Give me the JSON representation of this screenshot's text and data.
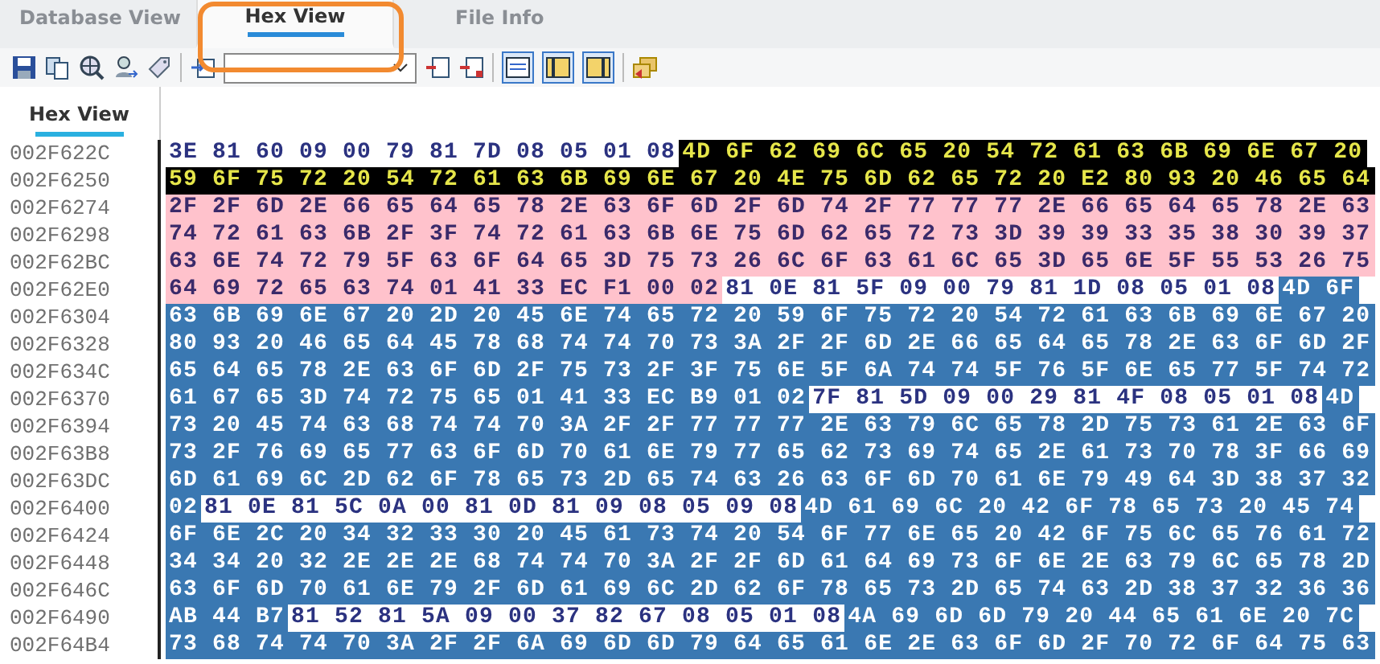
{
  "tabs": [
    {
      "label": "Database View",
      "selected": false
    },
    {
      "label": "Hex View",
      "selected": true
    },
    {
      "label": "File Info",
      "selected": false
    }
  ],
  "toolbar": {
    "toggles": [
      {
        "pressed": true
      },
      {
        "pressed": true
      },
      {
        "pressed": true
      }
    ]
  },
  "subtabs": [
    {
      "label": "Hex View",
      "selected": true
    }
  ],
  "rows": [
    {
      "address": "002F622C",
      "segments": [
        {
          "kind": "plain",
          "bytes": "3E 81 60 09 00 79 81 7D 08 05 01 08"
        },
        {
          "kind": "black",
          "bytes": "4D 6F 62 69 6C 65 20 54 72 61 63 6B 69 6E 67 20"
        }
      ]
    },
    {
      "address": "002F6250",
      "segments": [
        {
          "kind": "black",
          "bytes": "59 6F 75 72 20 54 72 61 63 6B 69 6E 67 20 4E 75 6D 62 65 72 20 E2 80 93 20 46 65 64"
        }
      ]
    },
    {
      "address": "002F6274",
      "segments": [
        {
          "kind": "pink",
          "bytes": "2F 2F 6D 2E 66 65 64 65 78 2E 63 6F 6D 2F 6D 74 2F 77 77 77 2E 66 65 64 65 78 2E 63"
        }
      ]
    },
    {
      "address": "002F6298",
      "segments": [
        {
          "kind": "pink",
          "bytes": "74 72 61 63 6B 2F 3F 74 72 61 63 6B 6E 75 6D 62 65 72 73 3D 39 39 33 35 38 30 39 37"
        }
      ]
    },
    {
      "address": "002F62BC",
      "segments": [
        {
          "kind": "pink",
          "bytes": "63 6E 74 72 79 5F 63 6F 64 65 3D 75 73 26 6C 6F 63 61 6C 65 3D 65 6E 5F 55 53 26 75"
        }
      ]
    },
    {
      "address": "002F62E0",
      "segments": [
        {
          "kind": "pink",
          "bytes": "64 69 72 65 63 74 01 41 33 EC F1 00 02"
        },
        {
          "kind": "plain",
          "bytes": "81 0E 81 5F 09 00 79 81 1D 08 05 01 08"
        },
        {
          "kind": "blue",
          "bytes": "4D 6F"
        }
      ]
    },
    {
      "address": "002F6304",
      "segments": [
        {
          "kind": "blue",
          "bytes": "63 6B 69 6E 67 20 2D 20 45 6E 74 65 72 20 59 6F 75 72 20 54 72 61 63 6B 69 6E 67 20"
        }
      ]
    },
    {
      "address": "002F6328",
      "segments": [
        {
          "kind": "blue",
          "bytes": "80 93 20 46 65 64 45 78 68 74 74 70 73 3A 2F 2F 6D 2E 66 65 64 65 78 2E 63 6F 6D 2F"
        }
      ]
    },
    {
      "address": "002F634C",
      "segments": [
        {
          "kind": "blue",
          "bytes": "65 64 65 78 2E 63 6F 6D 2F 75 73 2F 3F 75 6E 5F 6A 74 74 5F 76 5F 6E 65 77 5F 74 72"
        }
      ]
    },
    {
      "address": "002F6370",
      "segments": [
        {
          "kind": "blue",
          "bytes": "61 67 65 3D 74 72 75 65 01 41 33 EC B9 01 02"
        },
        {
          "kind": "plain",
          "bytes": "7F 81 5D 09 00 29 81 4F 08 05 01 08"
        },
        {
          "kind": "blue",
          "bytes": "4D"
        }
      ]
    },
    {
      "address": "002F6394",
      "segments": [
        {
          "kind": "blue",
          "bytes": "73 20 45 74 63 68 74 74 70 3A 2F 2F 77 77 77 2E 63 79 6C 65 78 2D 75 73 61 2E 63 6F"
        }
      ]
    },
    {
      "address": "002F63B8",
      "segments": [
        {
          "kind": "blue",
          "bytes": "73 2F 76 69 65 77 63 6F 6D 70 61 6E 79 77 65 62 73 69 74 65 2E 61 73 70 78 3F 66 69"
        }
      ]
    },
    {
      "address": "002F63DC",
      "segments": [
        {
          "kind": "blue",
          "bytes": "6D 61 69 6C 2D 62 6F 78 65 73 2D 65 74 63 26 63 6F 6D 70 61 6E 79 49 64 3D 38 37 32"
        }
      ]
    },
    {
      "address": "002F6400",
      "segments": [
        {
          "kind": "blue",
          "bytes": "02"
        },
        {
          "kind": "plain",
          "bytes": "81 0E 81 5C 0A 00 81 0D 81 09 08 05 09 08"
        },
        {
          "kind": "blue",
          "bytes": "4D 61 69 6C 20 42 6F 78 65 73 20 45 74"
        }
      ]
    },
    {
      "address": "002F6424",
      "segments": [
        {
          "kind": "blue",
          "bytes": "6F 6E 2C 20 34 32 33 30 20 45 61 73 74 20 54 6F 77 6E 65 20 42 6F 75 6C 65 76 61 72"
        }
      ]
    },
    {
      "address": "002F6448",
      "segments": [
        {
          "kind": "blue",
          "bytes": "34 34 20 32 2E 2E 2E 68 74 74 70 3A 2F 2F 6D 61 64 69 73 6F 6E 2E 63 79 6C 65 78 2D"
        }
      ]
    },
    {
      "address": "002F646C",
      "segments": [
        {
          "kind": "blue",
          "bytes": "63 6F 6D 70 61 6E 79 2F 6D 61 69 6C 2D 62 6F 78 65 73 2D 65 74 63 2D 38 37 32 36 36"
        }
      ]
    },
    {
      "address": "002F6490",
      "segments": [
        {
          "kind": "blue",
          "bytes": "AB 44 B7"
        },
        {
          "kind": "plain",
          "bytes": "81 52 81 5A 09 00 37 82 67 08 05 01 08"
        },
        {
          "kind": "blue",
          "bytes": "4A 69 6D 6D 79 20 44 65 61 6E 20 7C"
        }
      ]
    },
    {
      "address": "002F64B4",
      "segments": [
        {
          "kind": "blue",
          "bytes": "73 68 74 74 70 3A 2F 2F 6A 69 6D 6D 79 64 65 61 6E 2E 63 6F 6D 2F 70 72 6F 64 75 63"
        }
      ]
    }
  ]
}
